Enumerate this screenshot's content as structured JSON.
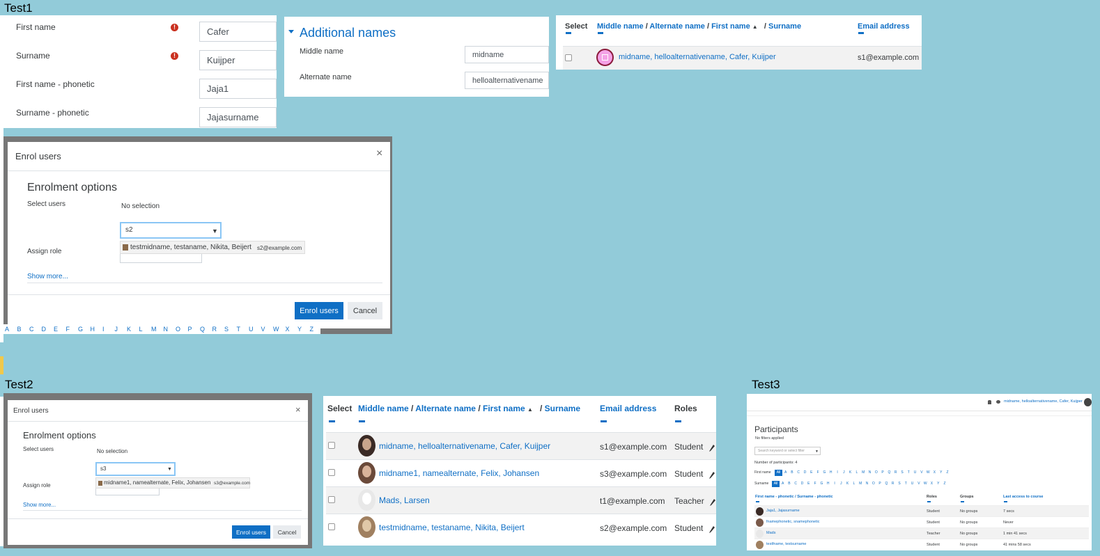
{
  "tests": {
    "t1": "Test1",
    "t2": "Test2",
    "t3": "Test3"
  },
  "profile_form": {
    "fields": [
      {
        "label": "First name",
        "value": "Cafer",
        "required": true
      },
      {
        "label": "Surname",
        "value": "Kuijper",
        "required": true
      },
      {
        "label": "First name - phonetic",
        "value": "Jaja1",
        "required": false
      },
      {
        "label": "Surname - phonetic",
        "value": "Jajasurname",
        "required": false
      }
    ],
    "required_icon": "!"
  },
  "additional_names": {
    "title": "Additional names",
    "fields": [
      {
        "label": "Middle name",
        "value": "midname"
      },
      {
        "label": "Alternate name",
        "value": "helloalternativename"
      }
    ]
  },
  "table1": {
    "headers": {
      "select": "Select",
      "middle": "Middle name",
      "alternate": "Alternate name",
      "first": "First name",
      "surname": "Surname",
      "email": "Email address",
      "sep": "/"
    },
    "row": {
      "name": "midname, helloalternativename, Cafer, Kuijper",
      "email": "s1@example.com"
    }
  },
  "enrol1": {
    "title": "Enrol users",
    "close": "×",
    "heading": "Enrolment options",
    "select_users": "Select users",
    "no_selection": "No selection",
    "search_value": "s2",
    "caret": "▼",
    "suggestion_name": "testmidname, testaname, Nikita, Beijert",
    "suggestion_email": "s2@example.com",
    "assign_role": "Assign role",
    "show_more": "Show more...",
    "enrol_btn": "Enrol users",
    "cancel_btn": "Cancel"
  },
  "alphabet": [
    "A",
    "B",
    "C",
    "D",
    "E",
    "F",
    "G",
    "H",
    "I",
    "J",
    "K",
    "L",
    "M",
    "N",
    "O",
    "P",
    "Q",
    "R",
    "S",
    "T",
    "U",
    "V",
    "W",
    "X",
    "Y",
    "Z"
  ],
  "enrol2": {
    "title": "Enrol users",
    "close": "×",
    "heading": "Enrolment options",
    "select_users": "Select users",
    "no_selection": "No selection",
    "search_value": "s3",
    "caret": "▼",
    "suggestion_name": "midname1, namealternate, Felix, Johansen",
    "suggestion_email": "s3@example.com",
    "assign_role": "Assign role",
    "show_more": "Show more...",
    "enrol_btn": "Enrol users",
    "cancel_btn": "Cancel"
  },
  "table2": {
    "headers": {
      "select": "Select",
      "middle": "Middle name",
      "alternate": "Alternate name",
      "first": "First name",
      "surname": "Surname",
      "email": "Email address",
      "roles": "Roles",
      "sep": "/"
    },
    "rows": [
      {
        "name": "midname, helloalternativename, Cafer, Kuijper",
        "email": "s1@example.com",
        "role": "Student"
      },
      {
        "name": "midname1, namealternate, Felix, Johansen",
        "email": "s3@example.com",
        "role": "Student"
      },
      {
        "name": "Mads, Larsen",
        "email": "t1@example.com",
        "role": "Teacher"
      },
      {
        "name": "testmidname, testaname, Nikita, Beijert",
        "email": "s2@example.com",
        "role": "Student"
      }
    ]
  },
  "participants": {
    "user": "midname, helloalternativename, Cafer, Kuijper",
    "title": "Participants",
    "filters": "No filters applied",
    "search_placeholder": "Search keyword or select filter",
    "count": "Number of participants: 4",
    "first_name_label": "First name",
    "surname_label": "Surname",
    "all": "All",
    "headers": {
      "name": "First name - phonetic / Surname - phonetic",
      "roles": "Roles",
      "groups": "Groups",
      "access": "Last access to course"
    },
    "rows": [
      {
        "name": "Jaja1, Jajasurname",
        "role": "Student",
        "groups": "No groups",
        "access": "7 secs"
      },
      {
        "name": "fnamephonetic, snamephonetic",
        "role": "Student",
        "groups": "No groups",
        "access": "Never"
      },
      {
        "name": "Mads",
        "role": "Teacher",
        "groups": "No groups",
        "access": "1 min 41 secs"
      },
      {
        "name": "testfname, testsurname",
        "role": "Student",
        "groups": "No groups",
        "access": "41 mins 58 secs"
      }
    ]
  },
  "colors": {
    "link": "#0f6fc5",
    "bg": "#92cbd9",
    "required": "#ca3120",
    "frame": "#777777"
  }
}
